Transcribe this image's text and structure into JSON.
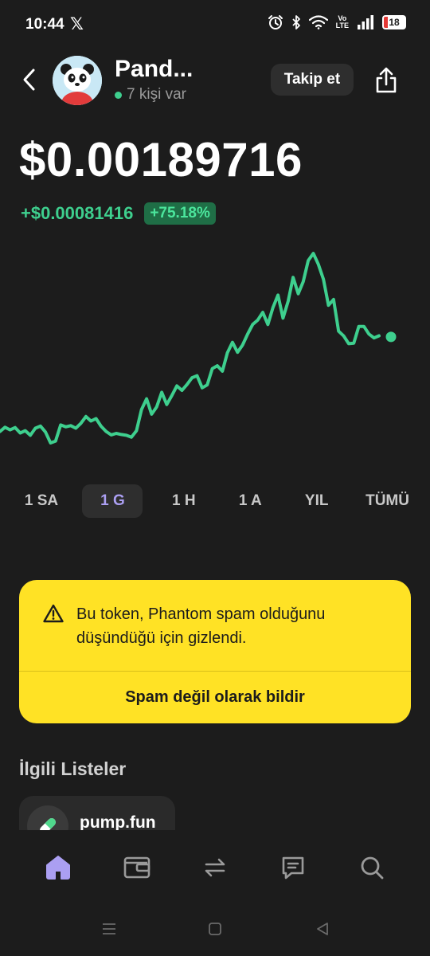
{
  "status_bar": {
    "time": "10:44",
    "app_icon": "x-logo-icon",
    "x_glyph": "𝕏",
    "volte_top": "Vo",
    "volte_bottom": "LTE",
    "battery_level": "18"
  },
  "header": {
    "token_name": "Pand...",
    "holders": "7 kişi var",
    "follow_label": "Takip et"
  },
  "price": {
    "value": "$0.00189716",
    "change": "+$0.00081416",
    "change_percent": "+75.18%"
  },
  "colors": {
    "positive": "#3ecf8e",
    "accent": "#ab9ff2",
    "warning_bg": "#ffe225",
    "background": "#1c1c1c"
  },
  "chart_data": {
    "type": "line",
    "title": "",
    "xlabel": "",
    "ylabel": "",
    "grid": false,
    "series": [
      {
        "values": [
          0.001148,
          0.00117,
          0.001156,
          0.001168,
          0.00114,
          0.001152,
          0.001128,
          0.001165,
          0.001176,
          0.001145,
          0.001088,
          0.001098,
          0.001182,
          0.001172,
          0.001178,
          0.001165,
          0.00119,
          0.001226,
          0.001202,
          0.001215,
          0.001175,
          0.001148,
          0.00113,
          0.001138,
          0.001132,
          0.001128,
          0.001118,
          0.001152,
          0.001262,
          0.001318,
          0.001238,
          0.001275,
          0.001352,
          0.001288,
          0.001335,
          0.001385,
          0.001362,
          0.001392,
          0.001428,
          0.001438,
          0.001375,
          0.00139,
          0.001475,
          0.00149,
          0.001462,
          0.001558,
          0.001612,
          0.00156,
          0.001598,
          0.001655,
          0.001705,
          0.001728,
          0.001768,
          0.001705,
          0.001792,
          0.001858,
          0.001738,
          0.001825,
          0.00195,
          0.001865,
          0.001928,
          0.002038,
          0.002075,
          0.002018,
          0.00194,
          0.001805,
          0.001835,
          0.00167,
          0.001645,
          0.001605,
          0.001608,
          0.001695,
          0.001695,
          0.001655,
          0.001635,
          0.001646
        ]
      }
    ],
    "last_value": 0.00164,
    "ylim": [
      0.00103,
      0.00215
    ]
  },
  "ranges": [
    "1 SA",
    "1 G",
    "1 H",
    "1 A",
    "YIL",
    "TÜMÜ"
  ],
  "active_range": "1 G",
  "warning": {
    "icon": "warning-triangle-icon",
    "message": "Bu token, Phantom spam olduğunu düşündüğü için gizlendi.",
    "action": "Spam değil olarak bildir"
  },
  "related": {
    "title": "İlgili Listeler",
    "items": [
      {
        "label": "pump.fun",
        "icon": "pill-icon"
      }
    ]
  },
  "bottom_nav": [
    {
      "name": "home",
      "icon": "home-icon",
      "active": true
    },
    {
      "name": "wallet",
      "icon": "wallet-icon",
      "active": false
    },
    {
      "name": "swap",
      "icon": "swap-icon",
      "active": false
    },
    {
      "name": "activity",
      "icon": "chat-icon",
      "active": false
    },
    {
      "name": "search",
      "icon": "search-icon",
      "active": false
    }
  ]
}
